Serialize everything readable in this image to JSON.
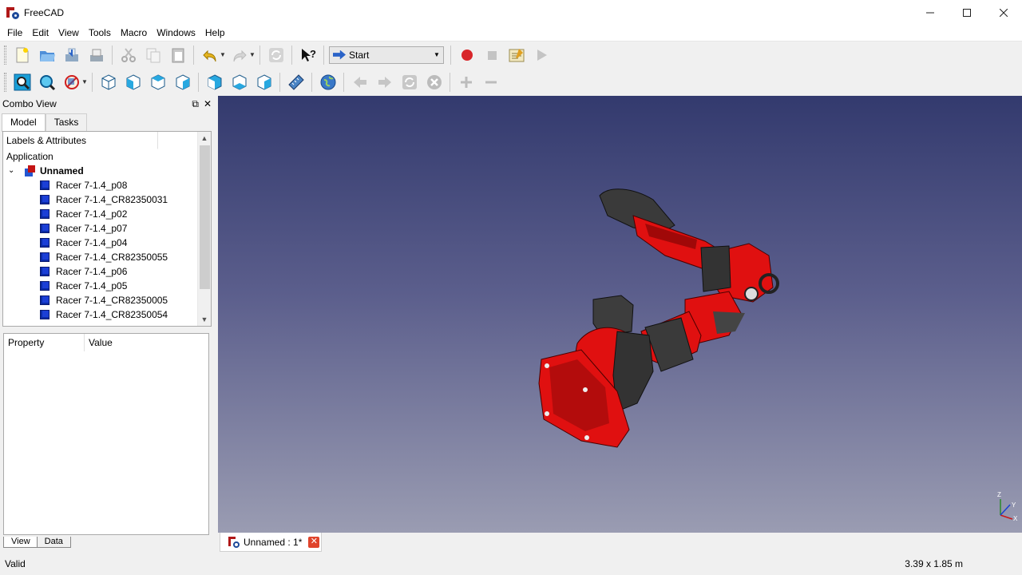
{
  "window": {
    "title": "FreeCAD",
    "minimize_label": "–",
    "maximize_label": "☐",
    "close_label": "✕"
  },
  "menu": {
    "items": [
      "File",
      "Edit",
      "View",
      "Tools",
      "Macro",
      "Windows",
      "Help"
    ]
  },
  "toolbar1": {
    "icons": [
      "new-file-icon",
      "open-file-icon",
      "save-icon",
      "save-as-icon",
      "cut-icon",
      "copy-icon",
      "paste-icon",
      "undo-icon",
      "redo-icon",
      "refresh-icon",
      "whats-this-icon"
    ],
    "workbench_select": "Start",
    "macro_icons": [
      "record-macro-icon",
      "stop-macro-icon",
      "macros-edit-icon",
      "execute-macro-icon"
    ]
  },
  "toolbar2": {
    "icons": [
      "fit-all-icon",
      "fit-selection-icon",
      "draw-style-icon",
      "isometric-view-icon",
      "front-view-icon",
      "top-view-icon",
      "right-view-icon",
      "rear-view-icon",
      "bottom-view-icon",
      "left-view-icon",
      "measure-distance-icon",
      "web-icon",
      "back-icon",
      "forward-icon",
      "web-refresh-icon",
      "web-stop-icon",
      "zoom-in-icon",
      "zoom-out-icon"
    ]
  },
  "combo": {
    "title": "Combo View",
    "tabs": [
      "Model",
      "Tasks"
    ],
    "tree_header": "Labels & Attributes",
    "application_label": "Application",
    "document_label": "Unnamed",
    "items": [
      "Racer 7-1.4_p08",
      "Racer 7-1.4_CR82350031",
      "Racer 7-1.4_p02",
      "Racer 7-1.4_p07",
      "Racer 7-1.4_p04",
      "Racer 7-1.4_CR82350055",
      "Racer 7-1.4_p06",
      "Racer 7-1.4_p05",
      "Racer 7-1.4_CR82350005",
      "Racer 7-1.4_CR82350054"
    ],
    "property_header": "Property",
    "value_header": "Value",
    "bottom_tabs": [
      "View",
      "Data"
    ]
  },
  "document_tab": {
    "label": "Unnamed : 1*"
  },
  "status": {
    "text": "Valid",
    "dimensions": "3.39 x 1.85 m"
  },
  "colors": {
    "viewport_top": "#333a6e",
    "viewport_bottom": "#9a9cb2",
    "model_red": "#e01010",
    "model_dark": "#3a3a3a"
  }
}
